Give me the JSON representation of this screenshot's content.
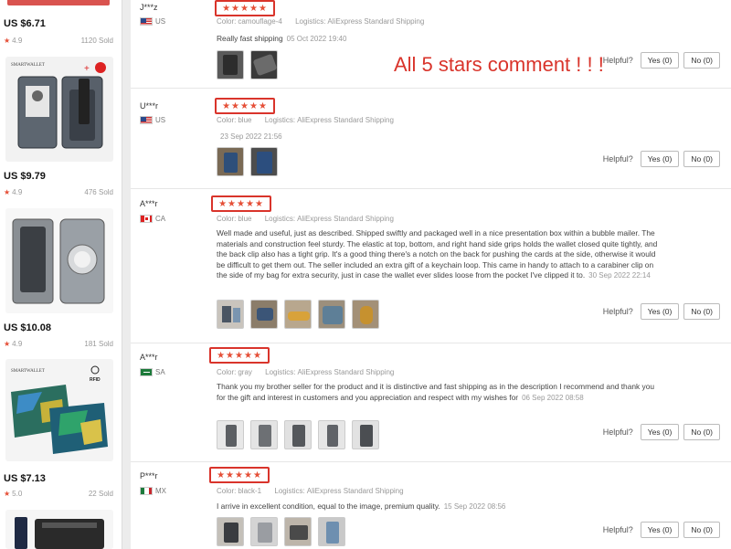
{
  "products": [
    {
      "price": "US $6.71",
      "rating": "4.9",
      "sold": "1120 Sold",
      "brand": "SMARTWALLET"
    },
    {
      "price": "US $9.79",
      "rating": "4.9",
      "sold": "476 Sold"
    },
    {
      "price": "US $10.08",
      "rating": "4.9",
      "sold": "181 Sold",
      "brand": "SMARTWALLET",
      "badge": "RFID"
    },
    {
      "price": "US $7.13",
      "rating": "5.0",
      "sold": "22 Sold"
    }
  ],
  "annotation": "All 5 stars comment ! ! !",
  "labels": {
    "color": "Color:",
    "logistics": "Logistics:",
    "helpful": "Helpful?",
    "star_glyphs": "★★★★★"
  },
  "reviews": [
    {
      "user": "J***z",
      "country": "US",
      "flag": "us",
      "color": "camouflage-4",
      "logistics": "AliExpress Standard Shipping",
      "text": "Really fast shipping",
      "date": "05 Oct 2022 19:40",
      "photo_count": 2,
      "yes": "Yes (0)",
      "no": "No (0)",
      "rating": 5
    },
    {
      "user": "U***r",
      "country": "US",
      "flag": "us",
      "color": "blue",
      "logistics": "AliExpress Standard Shipping",
      "text": "",
      "date": "23 Sep 2022 21:56",
      "photo_count": 2,
      "yes": "Yes (0)",
      "no": "No (0)",
      "rating": 5
    },
    {
      "user": "A***r",
      "country": "CA",
      "flag": "ca",
      "color": "blue",
      "logistics": "AliExpress Standard Shipping",
      "text": "Well made and useful, just as described. Shipped swiftly and packaged well in a nice presentation box within a bubble mailer. The materials and construction feel sturdy. The elastic at top, bottom, and right hand side grips holds the wallet closed quite tightly, and the back clip also has a tight grip. It's a good thing there's a notch on the back for pushing the cards at the side, otherwise it would be difficult to get them out. The seller included an extra gift of a keychain loop. This came in handy to attach to a carabiner clip on the side of my bag for extra security, just in case the wallet ever slides loose from the pocket I've clipped it to.",
      "date": "30 Sep 2022 22:14",
      "photo_count": 5,
      "yes": "Yes (0)",
      "no": "No (0)",
      "rating": 5
    },
    {
      "user": "A***r",
      "country": "SA",
      "flag": "sa",
      "color": "gray",
      "logistics": "AliExpress Standard Shipping",
      "text": "Thank you my brother seller for the product and it is distinctive and fast shipping as in the description I recommend and thank you for the gift and interest in customers and you appreciation and respect with my wishes for",
      "date": "06 Sep 2022 08:58",
      "photo_count": 5,
      "yes": "Yes (0)",
      "no": "No (0)",
      "rating": 5
    },
    {
      "user": "P***r",
      "country": "MX",
      "flag": "mx",
      "color": "black-1",
      "logistics": "AliExpress Standard Shipping",
      "text": "I arrive in excellent condition, equal to the image, premium quality.",
      "date": "15 Sep 2022 08:56",
      "photo_count": 4,
      "yes": "Yes (0)",
      "no": "No (0)",
      "rating": 5
    }
  ],
  "colors": {
    "accent_red": "#d9342b",
    "star": "#e54f37",
    "muted": "#999999"
  }
}
